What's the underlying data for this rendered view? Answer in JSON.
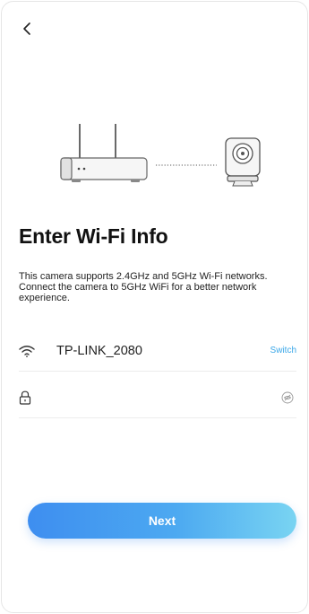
{
  "header": {
    "back_icon": "chevron-left-icon"
  },
  "main": {
    "title": "Enter Wi-Fi Info",
    "subtitle": "This camera supports 2.4GHz and 5GHz Wi-Fi networks. Connect the camera to 5GHz WiFi for a better network experience.",
    "wifi": {
      "icon": "wifi-icon",
      "ssid": "TP-LINK_2080",
      "switch_label": "Switch"
    },
    "password": {
      "icon": "lock-icon",
      "value": "",
      "placeholder": "",
      "toggle_icon": "eye-icon"
    },
    "next_label": "Next"
  },
  "colors": {
    "accent": "#3aa7e8",
    "button_start": "#3e8ef0",
    "button_end": "#79d4f2"
  }
}
